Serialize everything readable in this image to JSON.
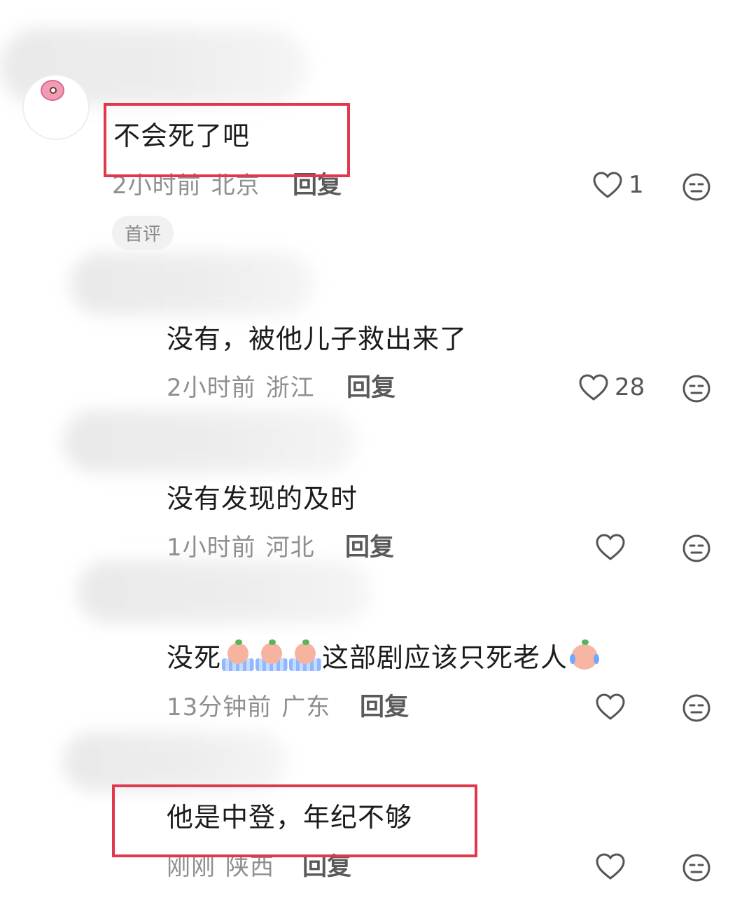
{
  "comments": [
    {
      "text": "不会死了吧",
      "time": "2小时前",
      "location": "北京",
      "reply": "回复",
      "likes": "1",
      "badge": "首评"
    },
    {
      "text": "没有，被他儿子救出来了",
      "time": "2小时前",
      "location": "浙江",
      "reply": "回复",
      "likes": "28"
    },
    {
      "text": "没有发现的及时",
      "time": "1小时前",
      "location": "河北",
      "reply": "回复",
      "likes": ""
    },
    {
      "text_before": "没死",
      "text_after": "这部剧应该只死老人",
      "time": "13分钟前",
      "location": "广东",
      "reply": "回复",
      "likes": "",
      "emojis": [
        "crying-bath-emoji",
        "crying-bath-emoji",
        "crying-bath-emoji",
        "laughing-crying-emoji"
      ]
    },
    {
      "text": "他是中登，年纪不够",
      "time": "刚刚",
      "location": "陕西",
      "reply": "回复",
      "likes": ""
    }
  ],
  "icons": {
    "like": "heart-outline-icon",
    "dislike": "neutral-face-icon"
  },
  "colors": {
    "highlight": "#e0394c",
    "meta_text": "#8f8f8f"
  }
}
